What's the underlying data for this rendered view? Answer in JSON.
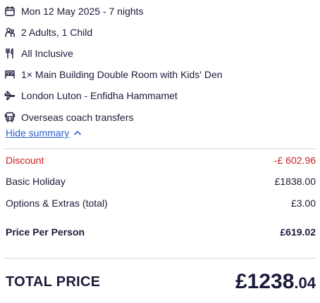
{
  "summary": {
    "items": [
      {
        "icon": "calendar-icon",
        "text": "Mon 12 May 2025 - 7 nights"
      },
      {
        "icon": "people-icon",
        "text": "2 Adults, 1 Child"
      },
      {
        "icon": "cutlery-icon",
        "text": "All Inclusive"
      },
      {
        "icon": "bed-icon",
        "text": "1× Main Building Double Room with Kids' Den"
      },
      {
        "icon": "plane-icon",
        "text": "London Luton - Enfidha Hammamet"
      },
      {
        "icon": "bus-icon",
        "text": "Overseas coach transfers"
      }
    ],
    "toggle_label": "Hide summary"
  },
  "prices": {
    "discount_label": "Discount",
    "discount_value": "-£ 602.96",
    "basic_label": "Basic Holiday",
    "basic_value": "£1838.00",
    "options_label": "Options & Extras (total)",
    "options_value": "£3.00",
    "per_person_label": "Price Per Person",
    "per_person_value": "£619.02"
  },
  "total": {
    "label": "TOTAL PRICE",
    "amount_main": "£1238",
    "amount_pence": ".04"
  },
  "colors": {
    "text": "#1b1b3a",
    "link": "#2f5fd0",
    "discount": "#c8241f",
    "divider": "#d9d9e0"
  }
}
